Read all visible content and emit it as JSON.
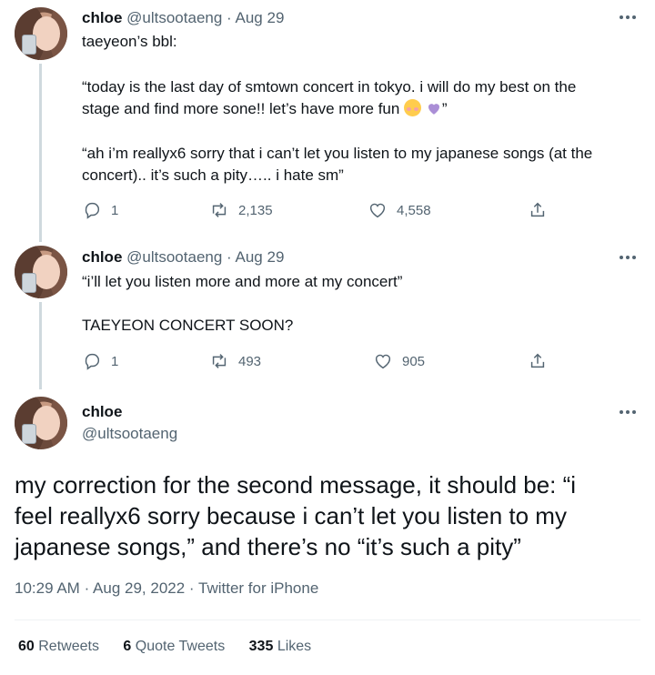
{
  "tweet1": {
    "name": "chloe",
    "handle": "@ultsootaeng",
    "separator": "·",
    "date": "Aug 29",
    "line1": "taeyeon’s bbl:",
    "line2": "“today is the last day of smtown concert in tokyo. i will do my best on the",
    "line3": "stage and find more sone!! let’s have more fun",
    "line3_end": "”",
    "line4": "“ah i’m reallyx6 sorry that i can’t let you listen to my japanese songs (at the",
    "line5": "concert).. it’s such a pity….. i hate sm”",
    "replies": "1",
    "retweets": "2,135",
    "likes": "4,558"
  },
  "tweet2": {
    "name": "chloe",
    "handle": "@ultsootaeng",
    "separator": "·",
    "date": "Aug 29",
    "line1": "“i’ll let you listen more and more at my concert”",
    "line2": "TAEYEON CONCERT SOON?",
    "replies": "1",
    "retweets": "493",
    "likes": "905"
  },
  "main": {
    "name": "chloe",
    "handle": "@ultsootaeng",
    "text_line1": "my correction for the second message, it should be: “i",
    "text_line2": "feel reallyx6 sorry because i can’t let you listen to my",
    "text_line3": "japanese songs,” and there’s no “it’s such a pity”",
    "time": "10:29 AM",
    "separator": "·",
    "date": "Aug 29, 2022",
    "separator2": "·",
    "source": "Twitter for iPhone",
    "retweets_count": "60",
    "retweets_label": "Retweets",
    "quotes_count": "6",
    "quotes_label": "Quote Tweets",
    "likes_count": "335",
    "likes_label": "Likes"
  },
  "icons": {
    "reply": "reply-icon",
    "retweet": "retweet-icon",
    "like": "heart-icon",
    "share": "share-icon",
    "more": "more-icon",
    "emoji1": "smiling-face-emoji",
    "emoji2": "purple-heart-emoji"
  },
  "colors": {
    "text": "#0f1419",
    "muted": "#536471",
    "thread_line": "#cfd9de",
    "purple_heart": "#aa8ed6"
  }
}
